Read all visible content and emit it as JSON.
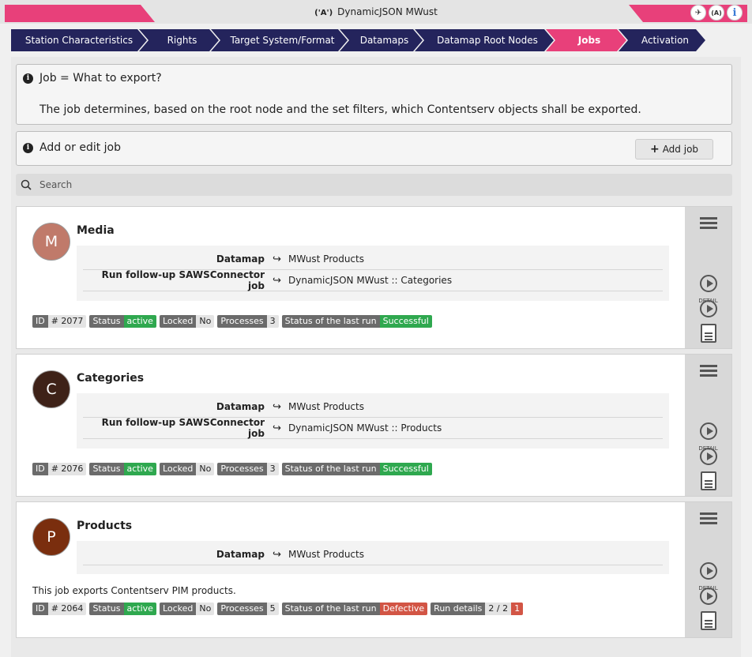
{
  "window": {
    "title": "DynamicJSON MWust",
    "antenna_glyph": "('A')"
  },
  "titlebar_icons": [
    "plane-icon",
    "antenna-icon",
    "info-icon"
  ],
  "nav": {
    "items": [
      {
        "label": "Station Characteristics",
        "active": false
      },
      {
        "label": "Rights",
        "active": false
      },
      {
        "label": "Target System/Format",
        "active": false
      },
      {
        "label": "Datamaps",
        "active": false
      },
      {
        "label": "Datamap Root Nodes",
        "active": false
      },
      {
        "label": "Jobs",
        "active": true
      },
      {
        "label": "Activation",
        "active": false
      }
    ]
  },
  "info": {
    "heading": "Job = What to export?",
    "body": "The job determines, based on the root node and the set filters, which Contentserv objects shall be exported."
  },
  "add_section": {
    "label": "Add or edit job",
    "button": "Add job"
  },
  "search": {
    "placeholder": "Search"
  },
  "jobs": [
    {
      "initial": "M",
      "name": "Media",
      "avatar_color": "#c07a6a",
      "props": [
        {
          "label": "Datamap",
          "value": "MWust Products"
        },
        {
          "label": "Run follow-up SAWSConnector job",
          "value": "DynamicJSON MWust :: Categories"
        }
      ],
      "description": "",
      "badges": {
        "id_label": "ID",
        "id_value": "# 2077",
        "status_label": "Status",
        "status_value": "active",
        "locked_label": "Locked",
        "locked_value": "No",
        "processes_label": "Processes",
        "processes_value": "3",
        "last_run_label": "Status of the last run",
        "last_run_value": "Successful"
      }
    },
    {
      "initial": "C",
      "name": "Categories",
      "avatar_color": "#3e2218",
      "props": [
        {
          "label": "Datamap",
          "value": "MWust Products"
        },
        {
          "label": "Run follow-up SAWSConnector job",
          "value": "DynamicJSON MWust :: Products"
        }
      ],
      "description": "",
      "badges": {
        "id_label": "ID",
        "id_value": "# 2076",
        "status_label": "Status",
        "status_value": "active",
        "locked_label": "Locked",
        "locked_value": "No",
        "processes_label": "Processes",
        "processes_value": "3",
        "last_run_label": "Status of the last run",
        "last_run_value": "Successful"
      }
    },
    {
      "initial": "P",
      "name": "Products",
      "avatar_color": "#7a2e0e",
      "props": [
        {
          "label": "Datamap",
          "value": "MWust Products"
        }
      ],
      "description": "This job exports Contentserv PIM products.",
      "badges": {
        "id_label": "ID",
        "id_value": "# 2064",
        "status_label": "Status",
        "status_value": "active",
        "locked_label": "Locked",
        "locked_value": "No",
        "processes_label": "Processes",
        "processes_value": "5",
        "last_run_label": "Status of the last run",
        "last_run_value": "Defective",
        "run_details_label": "Run details",
        "run_details_value": "2 / 2",
        "run_details_errors": "1"
      }
    }
  ],
  "side_labels": {
    "detail": "DETAIL"
  },
  "colors": {
    "accent": "#e8407a",
    "nav": "#24245c",
    "success": "#2fa84f",
    "danger": "#d25545"
  }
}
